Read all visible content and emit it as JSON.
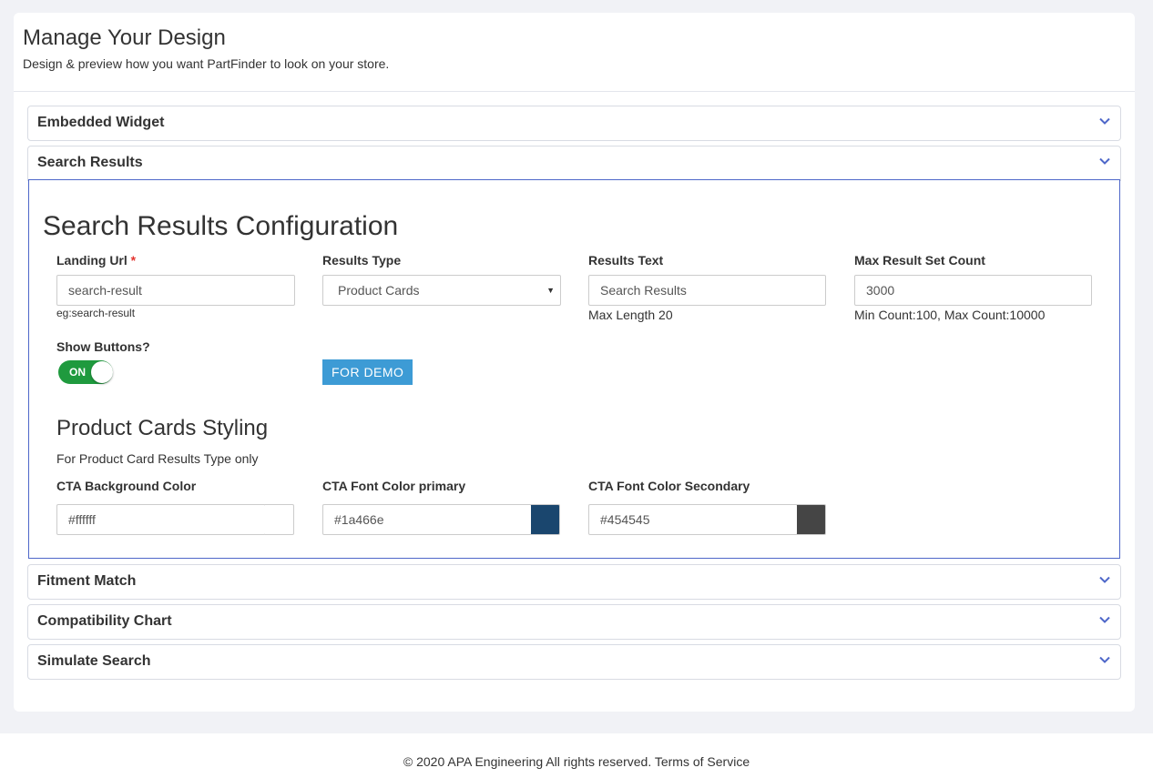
{
  "header": {
    "title": "Manage Your Design",
    "subtitle": "Design & preview how you want PartFinder to look on your store."
  },
  "panels": {
    "embedded_widget": "Embedded Widget",
    "search_results": "Search Results",
    "fitment_match": "Fitment Match",
    "compatibility_chart": "Compatibility Chart",
    "simulate_search": "Simulate Search"
  },
  "config": {
    "title": "Search Results Configuration",
    "landing_url": {
      "label": "Landing Url",
      "required_mark": "*",
      "value": "search-result",
      "hint": "eg:search-result"
    },
    "results_type": {
      "label": "Results Type",
      "selected": "Product Cards"
    },
    "results_text": {
      "label": "Results Text",
      "value": "Search Results",
      "hint": "Max Length 20"
    },
    "max_result": {
      "label": "Max Result Set Count",
      "value": "3000",
      "hint": "Min Count:100, Max Count:10000"
    },
    "show_buttons": {
      "label": "Show Buttons?",
      "toggle_text": "ON",
      "state": true
    },
    "demo_button": "FOR DEMO"
  },
  "styling": {
    "title": "Product Cards Styling",
    "note": "For Product Card Results Type only",
    "cta_bg": {
      "label": "CTA Background Color",
      "value": "#ffffff"
    },
    "cta_font_primary": {
      "label": "CTA Font Color primary",
      "value": "#1a466e"
    },
    "cta_font_secondary": {
      "label": "CTA Font Color Secondary",
      "value": "#454545"
    }
  },
  "colors": {
    "accent": "#4e67c9",
    "toggle_on": "#1f9a3e",
    "demo_button": "#3d9bd5"
  },
  "footer": {
    "text": "© 2020 APA Engineering All rights reserved. Terms of Service"
  }
}
